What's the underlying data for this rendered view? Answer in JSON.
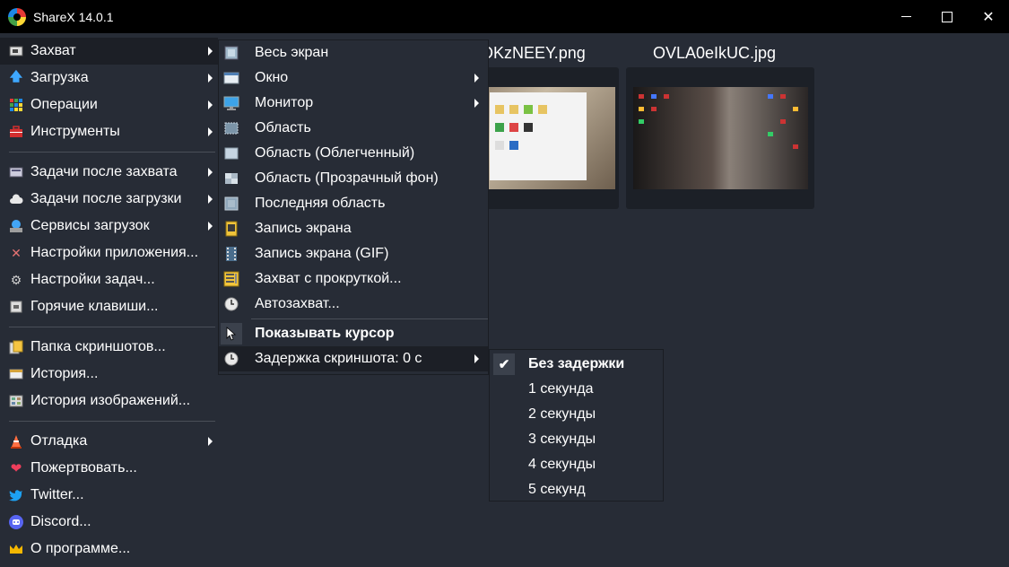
{
  "window": {
    "title": "ShareX 14.0.1",
    "controls": [
      "minimize",
      "maximize",
      "close"
    ]
  },
  "main_menu": [
    {
      "label": "Захват",
      "icon": "capture-icon",
      "submenu": true,
      "active": true
    },
    {
      "label": "Загрузка",
      "icon": "upload-arrow-icon",
      "submenu": true
    },
    {
      "label": "Операции",
      "icon": "workflows-icon",
      "submenu": true
    },
    {
      "label": "Инструменты",
      "icon": "toolbox-icon",
      "submenu": true
    },
    {
      "separator": true
    },
    {
      "label": "Задачи после захвата",
      "icon": "after-capture-icon",
      "submenu": true
    },
    {
      "label": "Задачи после загрузки",
      "icon": "cloud-icon",
      "submenu": true
    },
    {
      "label": "Сервисы загрузок",
      "icon": "destinations-icon",
      "submenu": true
    },
    {
      "label": "Настройки приложения...",
      "icon": "wrench-icon"
    },
    {
      "label": "Настройки задач...",
      "icon": "gear-icon"
    },
    {
      "label": "Горячие клавиши...",
      "icon": "keyboard-icon"
    },
    {
      "separator": true
    },
    {
      "label": "Папка скриншотов...",
      "icon": "folder-icon"
    },
    {
      "label": "История...",
      "icon": "history-icon"
    },
    {
      "label": "История изображений...",
      "icon": "image-history-icon"
    },
    {
      "separator": true
    },
    {
      "label": "Отладка",
      "icon": "traffic-cone-icon",
      "submenu": true
    },
    {
      "label": "Пожертвовать...",
      "icon": "heart-icon"
    },
    {
      "label": "Twitter...",
      "icon": "twitter-icon"
    },
    {
      "label": "Discord...",
      "icon": "discord-icon"
    },
    {
      "label": "О программе...",
      "icon": "crown-icon"
    }
  ],
  "capture_submenu": [
    {
      "label": "Весь экран",
      "icon": "fullscreen-icon"
    },
    {
      "label": "Окно",
      "icon": "window-icon",
      "submenu": true
    },
    {
      "label": "Монитор",
      "icon": "monitor-icon",
      "submenu": true
    },
    {
      "label": "Область",
      "icon": "region-icon"
    },
    {
      "label": "Область (Облегченный)",
      "icon": "region-light-icon"
    },
    {
      "label": "Область (Прозрачный фон)",
      "icon": "region-transparent-icon"
    },
    {
      "label": "Последняя область",
      "icon": "last-region-icon"
    },
    {
      "label": "Запись экрана",
      "icon": "screen-record-icon"
    },
    {
      "label": "Запись экрана (GIF)",
      "icon": "film-icon"
    },
    {
      "label": "Захват с прокруткой...",
      "icon": "scroll-capture-icon"
    },
    {
      "label": "Автозахват...",
      "icon": "clock-icon"
    },
    {
      "separator": true
    },
    {
      "label": "Показывать курсор",
      "icon": "cursor-icon",
      "bold": true
    },
    {
      "label": "Задержка скриншота: 0 с",
      "icon": "clock-icon",
      "submenu": true,
      "active": true
    }
  ],
  "delay_submenu": [
    {
      "label": "Без задержки",
      "checked": true
    },
    {
      "label": "1 секунда"
    },
    {
      "label": "2 секунды"
    },
    {
      "label": "3 секунды"
    },
    {
      "label": "4 секунды"
    },
    {
      "label": "5 секунд"
    }
  ],
  "thumbnails": [
    {
      "filename": "OKzNEEY.png",
      "visible_label": "OKzNEEY.png"
    },
    {
      "filename": "OVLA0eIkUC.jpg",
      "visible_label": "OVLA0eIkUC.jpg"
    }
  ],
  "colors": {
    "background": "#272c36",
    "titlebar": "#000000",
    "menu_active": "#1c1f26",
    "separator": "#4a4f58"
  }
}
